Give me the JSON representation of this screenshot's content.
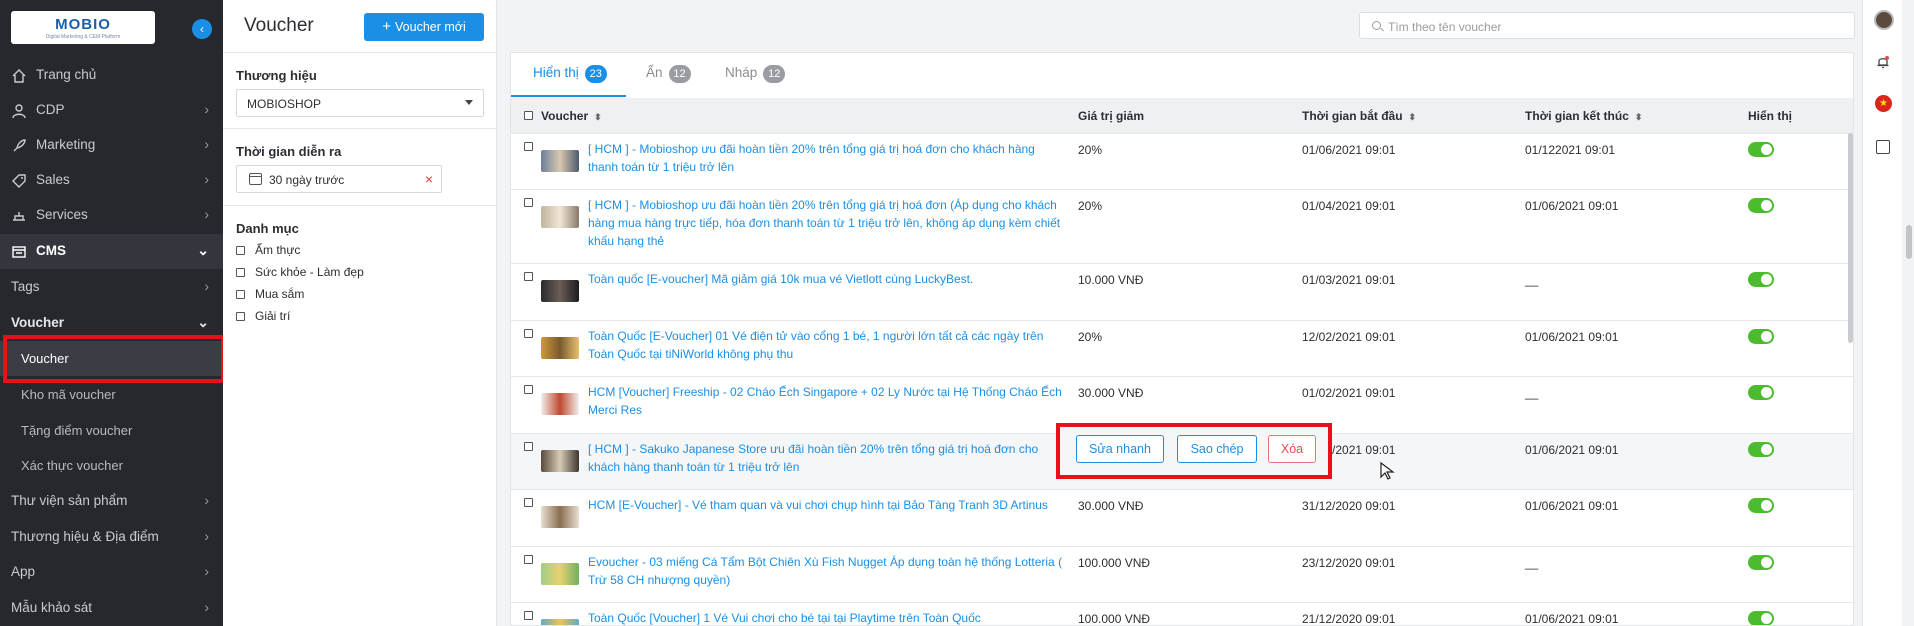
{
  "sidebar": {
    "logo": {
      "brand": "MOBIO",
      "tagline": "Digital Marketing & CEM Platform"
    },
    "items": [
      {
        "label": "Trang chủ",
        "icon": "home-icon"
      },
      {
        "label": "CDP",
        "icon": "user-icon"
      },
      {
        "label": "Marketing",
        "icon": "rocket-icon"
      },
      {
        "label": "Sales",
        "icon": "tag-icon"
      },
      {
        "label": "Services",
        "icon": "services-icon"
      },
      {
        "label": "CMS",
        "icon": "cms-icon"
      }
    ],
    "tags": "Tags",
    "voucher_section": "Voucher",
    "voucher_sub": [
      {
        "label": "Voucher"
      },
      {
        "label": "Kho mã voucher"
      },
      {
        "label": "Tặng điểm voucher"
      },
      {
        "label": "Xác thực voucher"
      }
    ],
    "more": [
      {
        "label": "Thư viện sản phẩm"
      },
      {
        "label": "Thương hiệu & Địa điểm"
      },
      {
        "label": "App"
      },
      {
        "label": "Mẫu khảo sát"
      }
    ]
  },
  "filter": {
    "page_title": "Voucher",
    "new_button": "Voucher mới",
    "brand_label": "Thương hiệu",
    "brand_value": "MOBIOSHOP",
    "time_label": "Thời gian diễn ra",
    "time_value": "30 ngày trước",
    "category_label": "Danh mục",
    "categories": [
      "Ẩm thực",
      "Sức khỏe - Làm đẹp",
      "Mua sắm",
      "Giải trí"
    ]
  },
  "search": {
    "placeholder": "Tìm theo tên voucher"
  },
  "tabs": [
    {
      "label": "Hiển thị",
      "count": "23"
    },
    {
      "label": "Ẩn",
      "count": "12"
    },
    {
      "label": "Nháp",
      "count": "12"
    }
  ],
  "table": {
    "headers": {
      "voucher": "Voucher",
      "discount": "Giá trị giảm",
      "start": "Thời gian bắt đầu",
      "end": "Thời gian kết thúc",
      "visible": "Hiển thị"
    },
    "rows": [
      {
        "name": "[ HCM ] -  Mobioshop ưu đãi hoàn tiền 20% trên tổng giá trị hoá đơn cho khách hàng thanh toán từ 1 triệu trở lên",
        "discount": "20%",
        "start": "01/06/2021 09:01",
        "end": "01/122021 09:01"
      },
      {
        "name": "[ HCM ] -  Mobioshop ưu đãi hoàn tiền 20% trên tổng giá trị hoá đơn (Áp dụng cho khách hàng mua hàng trực tiếp, hóa đơn thanh toán từ 1 triệu trở lên, không áp dụng kèm chiết khấu hạng thẻ",
        "discount": "20%",
        "start": "01/04/2021 09:01",
        "end": "01/06/2021 09:01"
      },
      {
        "name": "Toàn quốc [E-voucher] Mã giảm giá 10k mua vé Vietlott cùng LuckyBest.",
        "discount": "10.000 VNĐ",
        "start": "01/03/2021 09:01",
        "end": "__"
      },
      {
        "name": "Toàn Quốc [E-Voucher] 01 Vé điện tử vào cổng 1 bé, 1 người lớn tất cả các ngày trên Toàn Quốc tại tiNiWorld không phụ thu",
        "discount": "20%",
        "start": "12/02/2021 09:01",
        "end": "01/06/2021 09:01"
      },
      {
        "name": "HCM [Voucher] Freeship - 02 Cháo Ếch Singapore + 02 Ly Nước tại Hệ Thống Cháo Ếch Merci Res",
        "discount": "30.000 VNĐ",
        "start": "01/02/2021 09:01",
        "end": "__"
      },
      {
        "name": "[ HCM ] -  Sakuko Japanese Store ưu đãi hoàn tiền 20% trên tổng giá trị hoá đơn cho khách hàng thanh toán từ 1 triệu trở lên",
        "discount": "",
        "start": "01/01/2021 09:01",
        "end": "01/06/2021 09:01"
      },
      {
        "name": "HCM [E-Voucher] - Vé tham quan và vui chơi chụp hình tại Bảo Tàng Tranh 3D Artinus",
        "discount": "30.000 VNĐ",
        "start": "31/12/2020 09:01",
        "end": "01/06/2021 09:01"
      },
      {
        "name": "Evoucher - 03 miếng Cá Tẩm Bột Chiên Xù Fish Nugget Áp dụng toàn hệ thống Lotteria ( Trừ 58 CH nhượng quyền)",
        "discount": "100.000 VNĐ",
        "start": "23/12/2020 09:01",
        "end": "__"
      },
      {
        "name": "Toàn Quốc [Voucher] 1 Vé Vui chơi cho bé tại tại Playtime trên Toàn Quốc",
        "discount": "100.000 VNĐ",
        "start": "21/12/2020 09:01",
        "end": "01/06/2021 09:01"
      }
    ],
    "hover_actions": {
      "quick_edit": "Sửa nhanh",
      "copy": "Sao chép",
      "delete": "Xóa"
    }
  },
  "colors": {
    "accent": "#1b8fe6",
    "sidebar": "#26282d",
    "toggle_on": "#4cbc2e",
    "highlight": "#e8101a"
  }
}
